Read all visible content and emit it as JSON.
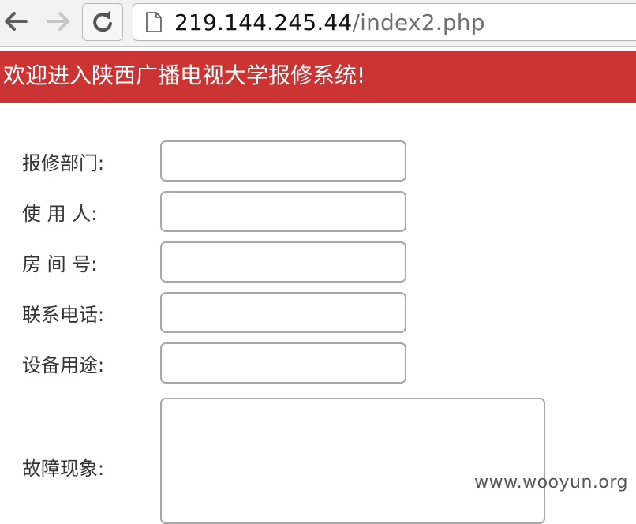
{
  "browser": {
    "url_host": "219.144.245.44",
    "url_path": "/index2.php",
    "icons": [
      "back-arrow-icon",
      "forward-arrow-icon",
      "reload-icon",
      "page-icon"
    ]
  },
  "banner": {
    "text": "欢迎进入陕西广播电视大学报修系统!",
    "background": "#cc3333"
  },
  "form": {
    "fields": [
      {
        "label": "报修部门:",
        "value": ""
      },
      {
        "label": "使 用 人:",
        "value": ""
      },
      {
        "label": "房 间 号:",
        "value": ""
      },
      {
        "label": "联系电话:",
        "value": ""
      },
      {
        "label": "设备用途:",
        "value": ""
      }
    ],
    "fault": {
      "label": "故障现象:",
      "value": ""
    }
  },
  "watermark": "www.wooyun.org"
}
